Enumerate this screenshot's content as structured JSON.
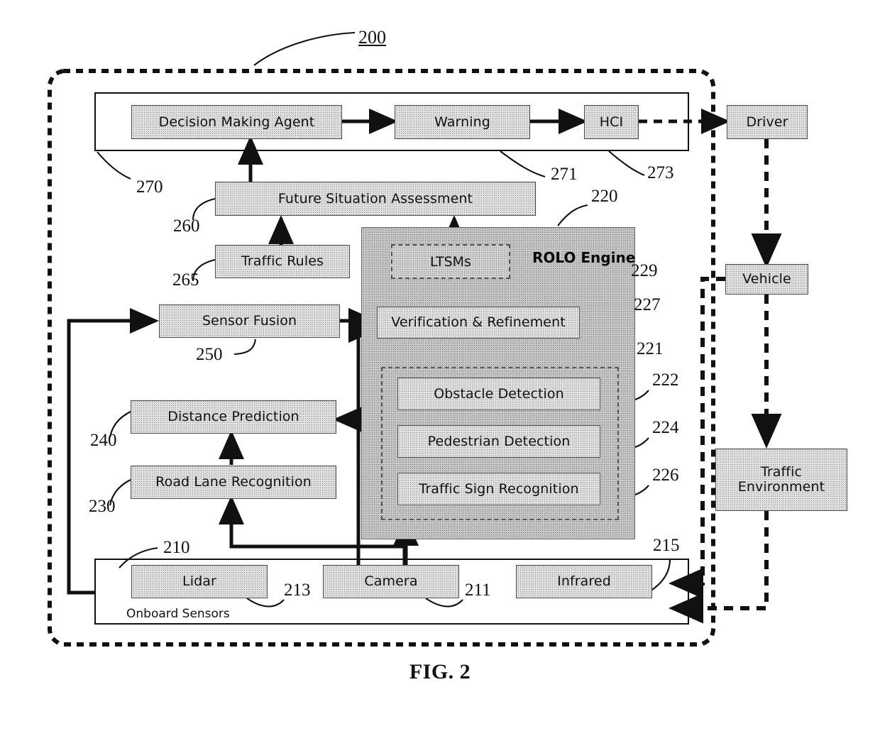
{
  "figure": {
    "caption": "FIG. 2",
    "system_number": "200"
  },
  "blocks": {
    "decision_making_agent": "Decision Making Agent",
    "warning": "Warning",
    "hci": "HCI",
    "driver": "Driver",
    "future_situation_assessment": "Future Situation Assessment",
    "traffic_rules": "Traffic Rules",
    "sensor_fusion": "Sensor Fusion",
    "ltsms": "LTSMs",
    "rolo_engine": "ROLO Engine",
    "verification_refinement": "Verification & Refinement",
    "obstacle_detection": "Obstacle Detection",
    "pedestrian_detection": "Pedestrian Detection",
    "traffic_sign_recognition": "Traffic Sign Recognition",
    "distance_prediction": "Distance Prediction",
    "road_lane_recognition": "Road Lane Recognition",
    "onboard_sensors": "Onboard Sensors",
    "lidar": "Lidar",
    "camera": "Camera",
    "infrared": "Infrared",
    "vehicle": "Vehicle",
    "traffic_environment": "Traffic\nEnvironment",
    "traffic_environment_line1": "Traffic",
    "traffic_environment_line2": "Environment"
  },
  "reference_numerals": {
    "n200": "200",
    "n210": "210",
    "n211": "211",
    "n213": "213",
    "n215": "215",
    "n220": "220",
    "n221": "221",
    "n222": "222",
    "n224": "224",
    "n226": "226",
    "n227": "227",
    "n229": "229",
    "n230": "230",
    "n240": "240",
    "n250": "250",
    "n260": "260",
    "n265": "265",
    "n270": "270",
    "n271": "271",
    "n273": "273"
  },
  "colors": {
    "fill_light": "#e2e2e2",
    "fill_rolo": "#c9c9c9",
    "stroke": "#111111",
    "dash_stroke": "#5a5a5a"
  }
}
